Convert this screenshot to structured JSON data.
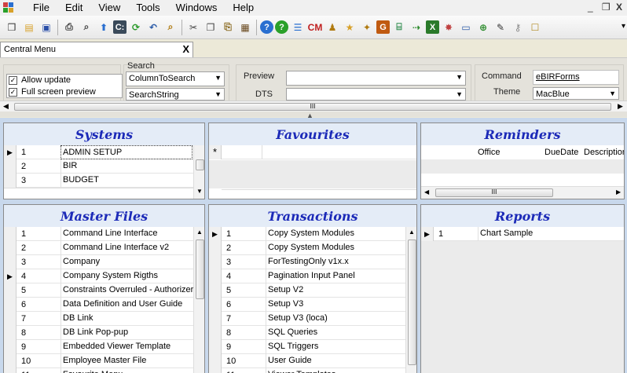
{
  "menu": [
    "File",
    "Edit",
    "View",
    "Tools",
    "Windows",
    "Help"
  ],
  "window_controls": [
    "_",
    "&#x2752;",
    "X"
  ],
  "toolbar": {
    "overflow": "▾",
    "buttons": [
      {
        "name": "new-icon",
        "glyph": "❒",
        "color": "#333"
      },
      {
        "name": "open-folder-icon",
        "glyph": "▤",
        "color": "#d8a12a"
      },
      {
        "name": "save-icon",
        "glyph": "▣",
        "color": "#2a4fa8"
      },
      {
        "sep": true
      },
      {
        "name": "print-icon",
        "glyph": "⎙",
        "color": "#444"
      },
      {
        "name": "print-preview-icon",
        "glyph": "⌕",
        "color": "#444"
      },
      {
        "name": "upload-icon",
        "glyph": "⬆",
        "color": "#2a6fd0"
      },
      {
        "name": "command-icon",
        "glyph": "C:",
        "color": "#fff",
        "bg": "#3a4a5a"
      },
      {
        "name": "refresh-icon",
        "glyph": "⟳",
        "color": "#2a9a2a"
      },
      {
        "name": "undo-icon",
        "glyph": "↶",
        "color": "#2a5aa8"
      },
      {
        "name": "find-icon",
        "glyph": "⌕",
        "color": "#b07a10"
      },
      {
        "sep": true
      },
      {
        "name": "cut-icon",
        "glyph": "✂",
        "color": "#444"
      },
      {
        "name": "copy-icon",
        "glyph": "❐",
        "color": "#444"
      },
      {
        "name": "paste-icon",
        "glyph": "⎘",
        "color": "#8a6a20"
      },
      {
        "name": "grid-icon",
        "glyph": "▦",
        "color": "#6a4a20"
      },
      {
        "sep": true
      },
      {
        "name": "help-icon",
        "glyph": "?",
        "color": "#fff",
        "bg": "#2a6fd0"
      },
      {
        "name": "about-icon",
        "glyph": "?",
        "color": "#fff",
        "bg": "#2aa02a"
      },
      {
        "name": "form-icon",
        "glyph": "☰",
        "color": "#2a6fd0"
      },
      {
        "name": "cm-icon",
        "glyph": "CM",
        "color": "#c02020"
      },
      {
        "name": "user-icon",
        "glyph": "♟",
        "color": "#b07a10"
      },
      {
        "name": "star-icon",
        "glyph": "★",
        "color": "#d8a12a"
      },
      {
        "name": "wand-icon",
        "glyph": "✦",
        "color": "#b07a10"
      },
      {
        "name": "g-icon",
        "glyph": "G",
        "color": "#fff",
        "bg": "#c05a10"
      },
      {
        "name": "database-icon",
        "glyph": "⌸",
        "color": "#2a8a4a"
      },
      {
        "name": "export-icon",
        "glyph": "⇢",
        "color": "#2a8a2a"
      },
      {
        "name": "excel-icon",
        "glyph": "X",
        "color": "#fff",
        "bg": "#2a7a2a"
      },
      {
        "name": "palette-icon",
        "glyph": "✸",
        "color": "#c04040"
      },
      {
        "name": "window-icon",
        "glyph": "▭",
        "color": "#2a5aa8"
      },
      {
        "name": "db-add-icon",
        "glyph": "⊕",
        "color": "#2a8a2a"
      },
      {
        "name": "pen-icon",
        "glyph": "✎",
        "color": "#333"
      },
      {
        "name": "key-icon",
        "glyph": "⚷",
        "color": "#888"
      },
      {
        "name": "lock-icon",
        "glyph": "☐",
        "color": "#b08a20"
      }
    ]
  },
  "tab": {
    "label": "Central Menu",
    "close": "X"
  },
  "options": {
    "allow_update": "Allow update",
    "full_screen_preview": "Full screen preview",
    "search_label": "Search",
    "search_column": "ColumnToSearch",
    "search_string": "SearchString",
    "preview_label": "Preview",
    "dts_label": "DTS",
    "command_label": "Command",
    "command_value": "eBIRForms",
    "theme_label": "Theme",
    "theme_value": "MacBlue"
  },
  "scroll_glyph": "III",
  "systems": {
    "title": "Systems",
    "rows": [
      {
        "no": "1",
        "name": "ADMIN SETUP"
      },
      {
        "no": "2",
        "name": "BIR"
      },
      {
        "no": "3",
        "name": "BUDGET"
      }
    ]
  },
  "favourites": {
    "title": "Favourites",
    "new_row": "*"
  },
  "reminders": {
    "title": "Reminders",
    "columns": [
      "Office",
      "DueDate",
      "Description"
    ]
  },
  "master_files": {
    "title": "Master Files",
    "rows": [
      {
        "no": "1",
        "name": "Command Line Interface"
      },
      {
        "no": "2",
        "name": "Command Line Interface v2"
      },
      {
        "no": "3",
        "name": "Company"
      },
      {
        "no": "4",
        "name": "Company System Rigths"
      },
      {
        "no": "5",
        "name": "Constraints Overruled - Authorizer"
      },
      {
        "no": "6",
        "name": "Data Definition and User Guide"
      },
      {
        "no": "7",
        "name": "DB Link"
      },
      {
        "no": "8",
        "name": "DB Link Pop-pup"
      },
      {
        "no": "9",
        "name": "Embedded Viewer Template"
      },
      {
        "no": "10",
        "name": "Employee Master File"
      },
      {
        "no": "11",
        "name": "Favourite Menu"
      }
    ]
  },
  "transactions": {
    "title": "Transactions",
    "rows": [
      {
        "no": "1",
        "name": "Copy System Modules"
      },
      {
        "no": "2",
        "name": "Copy System Modules"
      },
      {
        "no": "3",
        "name": "ForTestingOnly v1x.x"
      },
      {
        "no": "4",
        "name": "Pagination Input Panel"
      },
      {
        "no": "5",
        "name": "Setup V2"
      },
      {
        "no": "6",
        "name": "Setup V3"
      },
      {
        "no": "7",
        "name": "Setup V3 (loca)"
      },
      {
        "no": "8",
        "name": "SQL Queries"
      },
      {
        "no": "9",
        "name": "SQL Triggers"
      },
      {
        "no": "10",
        "name": "User Guide"
      },
      {
        "no": "11",
        "name": "Viewer Templates"
      }
    ]
  },
  "reports": {
    "title": "Reports",
    "rows": [
      {
        "no": "1",
        "name": "Chart Sample"
      }
    ]
  }
}
